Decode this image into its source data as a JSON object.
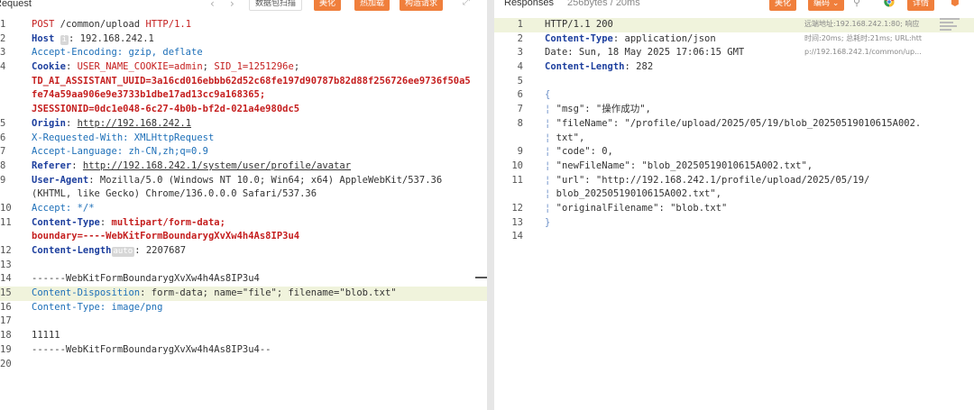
{
  "request_pane": {
    "title": "Request",
    "back_icon": "chevron-left",
    "forward_icon": "chevron-right",
    "btn_scan": "数据包扫描",
    "btn_beautify": "美化",
    "btn_hotload": "热加载",
    "btn_construct": "构造请求",
    "expand_icon": "expand",
    "lines": [
      {
        "n": "1"
      },
      {
        "n": "2"
      },
      {
        "n": "3"
      },
      {
        "n": "4"
      },
      {
        "n": ""
      },
      {
        "n": ""
      },
      {
        "n": ""
      },
      {
        "n": "5"
      },
      {
        "n": "6"
      },
      {
        "n": "7"
      },
      {
        "n": "8"
      },
      {
        "n": "9"
      },
      {
        "n": ""
      },
      {
        "n": "10"
      },
      {
        "n": "11"
      },
      {
        "n": ""
      },
      {
        "n": "12"
      },
      {
        "n": "13"
      },
      {
        "n": "14"
      },
      {
        "n": "15"
      },
      {
        "n": "16"
      },
      {
        "n": "17"
      },
      {
        "n": "18"
      },
      {
        "n": "19"
      },
      {
        "n": "20"
      }
    ],
    "text": {
      "l1_method": "POST",
      "l1_path": "/common/upload",
      "l1_proto": "HTTP/1.1",
      "l2_key": "Host",
      "l2_badge": "i",
      "l2_val": "192.168.242.1",
      "l3": "Accept-Encoding: gzip, deflate",
      "l4_key": "Cookie",
      "l4_c1": "USER_NAME_COOKIE=admin",
      "l4_c2": "SID_1=1251296e",
      "l5": "TD_AI_ASSISTANT_UUID=3a16cd016ebbb62d52c68fe197d90787b82d88f256726ee9736f50a5",
      "l6": "fe74a59aa906e9e3733b1dbe17ad13cc9a168365;",
      "l7": "JSESSIONID=0dc1e048-6c27-4b0b-bf2d-021a4e980dc5",
      "l8_key": "Origin",
      "l8_val": "http://192.168.242.1",
      "l9": "X-Requested-With: XMLHttpRequest",
      "l10": "Accept-Language: zh-CN,zh;q=0.9",
      "l11_key": "Referer",
      "l11_val": "http://192.168.242.1/system/user/profile/avatar",
      "l12_key": "User-Agent",
      "l12_val": "Mozilla/5.0 (Windows NT 10.0; Win64; x64) AppleWebKit/537.36",
      "l13": "(KHTML, like Gecko) Chrome/136.0.0.0 Safari/537.36",
      "l14": "Accept: */*",
      "l15_key": "Content-Type",
      "l15_val": "multipart/form-data;",
      "l16": "boundary=----WebKitFormBoundarygXvXw4h4As8IP3u4",
      "l17_key": "Content-Length",
      "l17_badge": "auto",
      "l17_val": "2207687",
      "l19": "------WebKitFormBoundarygXvXw4h4As8IP3u4",
      "l20_key": "Content-Disposition",
      "l20_val": "form-data; name=\"file\"; filename=\"blob.txt\"",
      "l21": "Content-Type: image/png",
      "l23": "11111",
      "l24": "------WebKitFormBoundarygXvXw4h4As8IP3u4--"
    }
  },
  "response_pane": {
    "title": "Responses",
    "size": "256bytes / 20ms",
    "btn_beautify": "美化",
    "btn_encode": "编码",
    "search_icon": "search",
    "chrome_icon": "chrome",
    "btn_detail": "详情",
    "shield_icon": "shield",
    "info_lines": [
      "远端地址:192.168.242.1:80; 响应",
      "时间:20ms; 总耗时:21ms; URL:htt",
      "p://192.168.242.1/common/up..."
    ],
    "lines": [
      {
        "n": "1"
      },
      {
        "n": "2"
      },
      {
        "n": "3"
      },
      {
        "n": "4"
      },
      {
        "n": "5"
      },
      {
        "n": "6"
      },
      {
        "n": "7"
      },
      {
        "n": "8"
      },
      {
        "n": ""
      },
      {
        "n": "9"
      },
      {
        "n": "10"
      },
      {
        "n": "11"
      },
      {
        "n": ""
      },
      {
        "n": "12"
      },
      {
        "n": "13"
      },
      {
        "n": "14"
      }
    ],
    "text": {
      "l1": "HTTP/1.1 200",
      "l2_key": "Content-Type",
      "l2_val": "application/json",
      "l3": "Date: Sun, 18 May 2025 17:06:15 GMT",
      "l4_key": "Content-Length",
      "l4_val": "282",
      "l6": "{",
      "l7": "\"msg\": \"操作成功\",",
      "l8a": "\"fileName\": \"/profile/upload/2025/05/19/blob_20250519010615A002.",
      "l8b": "txt\",",
      "l9": "\"code\": 0,",
      "l10": "\"newFileName\": \"blob_20250519010615A002.txt\",",
      "l11a": "\"url\": \"http://192.168.242.1/profile/upload/2025/05/19/",
      "l11b": "blob_20250519010615A002.txt\",",
      "l12": "\"originalFilename\": \"blob.txt\"",
      "l13": "}"
    }
  },
  "colors": {
    "accent_orange": "#f07f3c",
    "highlight_line": "#f0f3dc",
    "header_key_blue": "#1d3f9e",
    "method_red": "#c51f1f"
  }
}
